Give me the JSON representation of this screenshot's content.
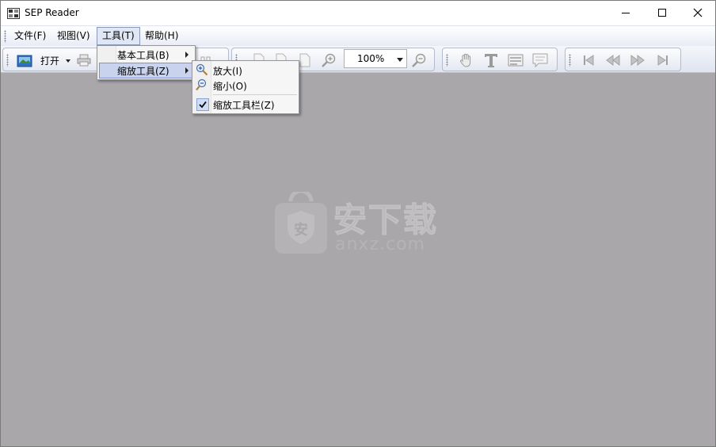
{
  "window": {
    "title": "SEP Reader"
  },
  "menubar": {
    "items": [
      {
        "label": "文件(F)"
      },
      {
        "label": "视图(V)"
      },
      {
        "label": "工具(T)"
      },
      {
        "label": "帮助(H)"
      }
    ],
    "active": "工具(T)"
  },
  "toolbar": {
    "open_label": "打开",
    "zoom_value": "100%",
    "icons": [
      "open-icon",
      "print-icon",
      "export-icon",
      "page-icon",
      "page-icon",
      "page-icon",
      "zoom-in-icon",
      "zoom-out-icon",
      "hand-icon",
      "text-select-icon",
      "snapshot-icon",
      "comment-icon",
      "first-page-icon",
      "prev-page-icon",
      "next-page-icon",
      "last-page-icon"
    ]
  },
  "tools_menu": {
    "items": [
      {
        "label": "基本工具(B)",
        "has_submenu": true
      },
      {
        "label": "缩放工具(Z)",
        "has_submenu": true,
        "highlighted": true
      }
    ]
  },
  "zoom_submenu": {
    "items": [
      {
        "label": "放大(I)",
        "icon": "zoom-in-icon"
      },
      {
        "label": "缩小(O)",
        "icon": "zoom-out-icon"
      },
      {
        "label": "缩放工具栏(Z)",
        "checked": true
      }
    ]
  },
  "watermark": {
    "cn": "安下载",
    "en": "anxz.com"
  },
  "colors": {
    "workarea": "#a9a7aa",
    "menu_highlight": "#c9d3ee",
    "toolbar": "#e4e8f1"
  }
}
